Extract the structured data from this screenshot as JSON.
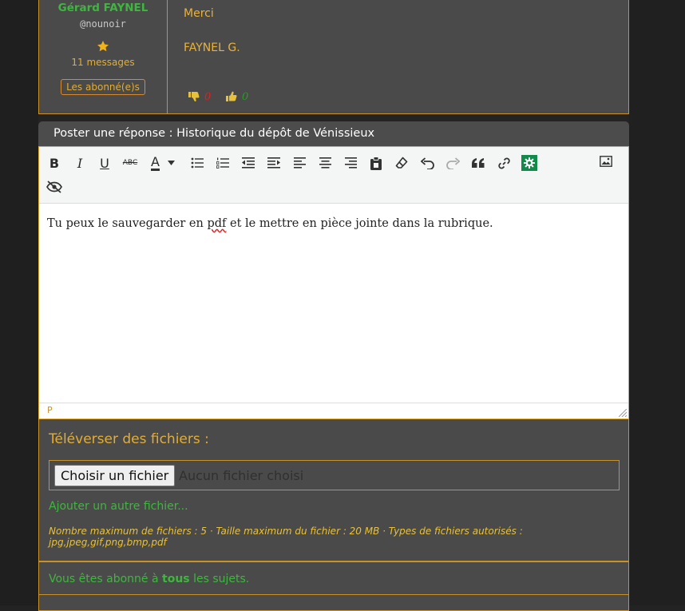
{
  "colors": {
    "page_bg": "#232323",
    "panel_bg": "#4a4a4a",
    "accent_border": "#c8912a",
    "gold_text": "#e3ad32",
    "green_text": "#3fb63f",
    "downvote": "#e02020",
    "upvote": "#2a9a2a"
  },
  "post": {
    "author": {
      "name": "Gérard FAYNEL",
      "handle": "@nounoir",
      "rank_icon": "star-icon",
      "messages": "11 messages",
      "badge": "Les abonné(e)s"
    },
    "body": {
      "line1": "Merci",
      "line2": "FAYNEL G."
    },
    "votes": {
      "down_icon": "thumbs-down-icon",
      "down_count": "0",
      "up_icon": "thumbs-up-icon",
      "up_count": "0"
    }
  },
  "reply": {
    "header": "Poster une réponse : Historique du dépôt de Vénissieux",
    "toolbar": [
      {
        "name": "bold",
        "icon": "bold-icon",
        "label": "B"
      },
      {
        "name": "italic",
        "icon": "italic-icon",
        "label": "I"
      },
      {
        "name": "underline",
        "icon": "underline-icon",
        "label": "U"
      },
      {
        "name": "strikethrough",
        "icon": "strikethrough-icon",
        "label": "ABC"
      },
      {
        "name": "text-color",
        "icon": "text-color-icon",
        "label": "A"
      },
      {
        "name": "bullet-list",
        "icon": "bullet-list-icon"
      },
      {
        "name": "numbered-list",
        "icon": "numbered-list-icon"
      },
      {
        "name": "outdent",
        "icon": "outdent-icon"
      },
      {
        "name": "indent",
        "icon": "indent-icon"
      },
      {
        "name": "align-left",
        "icon": "align-left-icon"
      },
      {
        "name": "align-center",
        "icon": "align-center-icon"
      },
      {
        "name": "align-right",
        "icon": "align-right-icon"
      },
      {
        "name": "paste",
        "icon": "clipboard-icon"
      },
      {
        "name": "clear-format",
        "icon": "eraser-icon"
      },
      {
        "name": "undo",
        "icon": "undo-icon"
      },
      {
        "name": "redo",
        "icon": "redo-icon"
      },
      {
        "name": "quote",
        "icon": "quote-icon"
      },
      {
        "name": "link",
        "icon": "link-icon"
      },
      {
        "name": "plugin",
        "icon": "gear-icon"
      },
      {
        "name": "image",
        "icon": "image-icon"
      },
      {
        "name": "hide",
        "icon": "eye-slash-icon"
      }
    ],
    "content": {
      "before": "Tu peux le sauvegarder en ",
      "misspelled": "pdf",
      "after": " et le mettre en pièce jointe dans la rubrique."
    },
    "statusbar_path": "P"
  },
  "upload": {
    "title": "Téléverser des fichiers :",
    "choose_button": "Choisir un fichier",
    "file_status": "Aucun fichier choisi",
    "add_another": "Ajouter un autre fichier...",
    "limits_line1": "Nombre maximum de fichiers : 5 · Taille maximum du fichier : 20 MB · Types de fichiers autorisés :",
    "limits_line2": "jpg,jpeg,gif,png,bmp,pdf"
  },
  "subscription": {
    "before": "Vous êtes abonné à ",
    "strong": "tous",
    "after": " les sujets."
  }
}
